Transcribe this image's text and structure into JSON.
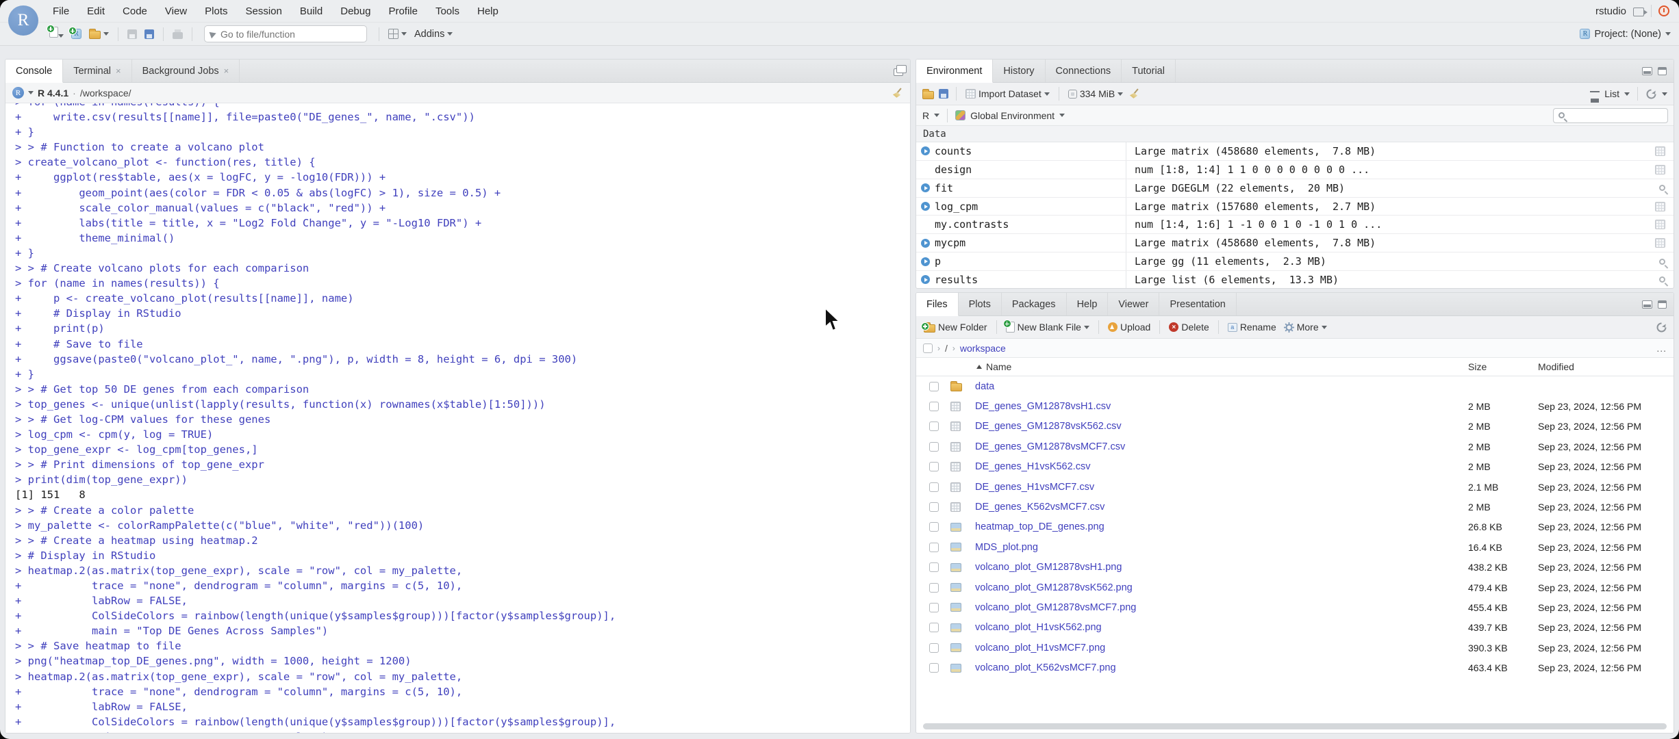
{
  "window": {
    "session_label": "rstudio",
    "project_label": "Project: (None)"
  },
  "colors": {
    "console_input": "#4040bd",
    "console_output": "#1b1b1b",
    "file_link": "#4040bd",
    "chrome": "#eceef0",
    "accent_logo": "#6b93c6",
    "power_icon": "#e0562c"
  },
  "menubar": {
    "items": [
      "File",
      "Edit",
      "Code",
      "View",
      "Plots",
      "Session",
      "Build",
      "Debug",
      "Profile",
      "Tools",
      "Help"
    ]
  },
  "toolbar": {
    "goto_placeholder": "Go to file/function",
    "addins_label": "Addins"
  },
  "console_panel": {
    "tabs": [
      {
        "label": "Console",
        "active": true,
        "closable": false
      },
      {
        "label": "Terminal",
        "active": false,
        "closable": true
      },
      {
        "label": "Background Jobs",
        "active": false,
        "closable": true
      }
    ],
    "r_version": "R 4.4.1",
    "separator": "·",
    "working_dir": "/workspace/",
    "lines": [
      {
        "k": "input",
        "t": "> for (name in names(results)) {"
      },
      {
        "k": "input",
        "t": "+     write.csv(results[[name]], file=paste0(\"DE_genes_\", name, \".csv\"))"
      },
      {
        "k": "input",
        "t": "+ }"
      },
      {
        "k": "input",
        "t": "> > # Function to create a volcano plot"
      },
      {
        "k": "input",
        "t": "> create_volcano_plot <- function(res, title) {"
      },
      {
        "k": "input",
        "t": "+     ggplot(res$table, aes(x = logFC, y = -log10(FDR))) +"
      },
      {
        "k": "input",
        "t": "+         geom_point(aes(color = FDR < 0.05 & abs(logFC) > 1), size = 0.5) +"
      },
      {
        "k": "input",
        "t": "+         scale_color_manual(values = c(\"black\", \"red\")) +"
      },
      {
        "k": "input",
        "t": "+         labs(title = title, x = \"Log2 Fold Change\", y = \"-Log10 FDR\") +"
      },
      {
        "k": "input",
        "t": "+         theme_minimal()"
      },
      {
        "k": "input",
        "t": "+ }"
      },
      {
        "k": "input",
        "t": "> > # Create volcano plots for each comparison"
      },
      {
        "k": "input",
        "t": "> for (name in names(results)) {"
      },
      {
        "k": "input",
        "t": "+     p <- create_volcano_plot(results[[name]], name)"
      },
      {
        "k": "input",
        "t": "+     # Display in RStudio"
      },
      {
        "k": "input",
        "t": "+     print(p)"
      },
      {
        "k": "input",
        "t": "+     # Save to file"
      },
      {
        "k": "input",
        "t": "+     ggsave(paste0(\"volcano_plot_\", name, \".png\"), p, width = 8, height = 6, dpi = 300)"
      },
      {
        "k": "input",
        "t": "+ }"
      },
      {
        "k": "input",
        "t": "> > # Get top 50 DE genes from each comparison"
      },
      {
        "k": "input",
        "t": "> top_genes <- unique(unlist(lapply(results, function(x) rownames(x$table)[1:50])))"
      },
      {
        "k": "input",
        "t": "> > # Get log-CPM values for these genes"
      },
      {
        "k": "input",
        "t": "> log_cpm <- cpm(y, log = TRUE)"
      },
      {
        "k": "input",
        "t": "> top_gene_expr <- log_cpm[top_genes,]"
      },
      {
        "k": "input",
        "t": "> > # Print dimensions of top_gene_expr"
      },
      {
        "k": "input",
        "t": "> print(dim(top_gene_expr))"
      },
      {
        "k": "output",
        "t": "[1] 151   8"
      },
      {
        "k": "input",
        "t": "> > # Create a color palette"
      },
      {
        "k": "input",
        "t": "> my_palette <- colorRampPalette(c(\"blue\", \"white\", \"red\"))(100)"
      },
      {
        "k": "input",
        "t": "> > # Create a heatmap using heatmap.2"
      },
      {
        "k": "input",
        "t": "> # Display in RStudio"
      },
      {
        "k": "input",
        "t": "> heatmap.2(as.matrix(top_gene_expr), scale = \"row\", col = my_palette,"
      },
      {
        "k": "input",
        "t": "+           trace = \"none\", dendrogram = \"column\", margins = c(5, 10),"
      },
      {
        "k": "input",
        "t": "+           labRow = FALSE,"
      },
      {
        "k": "input",
        "t": "+           ColSideColors = rainbow(length(unique(y$samples$group)))[factor(y$samples$group)],"
      },
      {
        "k": "input",
        "t": "+           main = \"Top DE Genes Across Samples\")"
      },
      {
        "k": "input",
        "t": "> > # Save heatmap to file"
      },
      {
        "k": "input",
        "t": "> png(\"heatmap_top_DE_genes.png\", width = 1000, height = 1200)"
      },
      {
        "k": "input",
        "t": "> heatmap.2(as.matrix(top_gene_expr), scale = \"row\", col = my_palette,"
      },
      {
        "k": "input",
        "t": "+           trace = \"none\", dendrogram = \"column\", margins = c(5, 10),"
      },
      {
        "k": "input",
        "t": "+           labRow = FALSE,"
      },
      {
        "k": "input",
        "t": "+           ColSideColors = rainbow(length(unique(y$samples$group)))[factor(y$samples$group)],"
      },
      {
        "k": "input",
        "t": "+           main = \"Top DE Genes Across Samples\")"
      }
    ]
  },
  "environment_panel": {
    "tabs": [
      "Environment",
      "History",
      "Connections",
      "Tutorial"
    ],
    "active_tab": "Environment",
    "toolbar": {
      "import_label": "Import Dataset",
      "memory_label": "334 MiB",
      "list_label": "List"
    },
    "scope": {
      "language": "R",
      "environment": "Global Environment"
    },
    "section_label": "Data",
    "objects": [
      {
        "name": "counts",
        "expandable": true,
        "value": "Large matrix (458680 elements,  7.8 MB)",
        "action": "grid"
      },
      {
        "name": "design",
        "expandable": false,
        "value": "num [1:8, 1:4] 1 1 0 0 0 0 0 0 0 0 ...",
        "action": "grid"
      },
      {
        "name": "fit",
        "expandable": true,
        "value": "Large DGEGLM (22 elements,  20 MB)",
        "action": "search"
      },
      {
        "name": "log_cpm",
        "expandable": true,
        "value": "Large matrix (157680 elements,  2.7 MB)",
        "action": "grid"
      },
      {
        "name": "my.contrasts",
        "expandable": false,
        "value": "num [1:4, 1:6] 1 -1 0 0 1 0 -1 0 1 0 ...",
        "action": "grid"
      },
      {
        "name": "mycpm",
        "expandable": true,
        "value": "Large matrix (458680 elements,  7.8 MB)",
        "action": "grid"
      },
      {
        "name": "p",
        "expandable": true,
        "value": "Large gg (11 elements,  2.3 MB)",
        "action": "search"
      },
      {
        "name": "results",
        "expandable": true,
        "value": "Large list (6 elements,  13.3 MB)",
        "action": "search"
      }
    ]
  },
  "files_panel": {
    "tabs": [
      "Files",
      "Plots",
      "Packages",
      "Help",
      "Viewer",
      "Presentation"
    ],
    "active_tab": "Files",
    "buttons": [
      {
        "label": "New Folder",
        "icon": "new-folder",
        "caret": false
      },
      {
        "label": "New Blank File",
        "icon": "new-file",
        "caret": true
      },
      {
        "label": "Upload",
        "icon": "upload",
        "caret": false
      },
      {
        "label": "Delete",
        "icon": "delete",
        "caret": false
      },
      {
        "label": "Rename",
        "icon": "rename",
        "caret": false
      },
      {
        "label": "More",
        "icon": "gear",
        "caret": true
      }
    ],
    "breadcrumb": [
      "/",
      "workspace"
    ],
    "ellipsis_label": "...",
    "columns": {
      "name": "Name",
      "size": "Size",
      "modified": "Modified"
    },
    "files": [
      {
        "name": "data",
        "type": "folder",
        "size": "",
        "modified": ""
      },
      {
        "name": "DE_genes_GM12878vsH1.csv",
        "type": "table",
        "size": "2 MB",
        "modified": "Sep 23, 2024, 12:56 PM"
      },
      {
        "name": "DE_genes_GM12878vsK562.csv",
        "type": "table",
        "size": "2 MB",
        "modified": "Sep 23, 2024, 12:56 PM"
      },
      {
        "name": "DE_genes_GM12878vsMCF7.csv",
        "type": "table",
        "size": "2 MB",
        "modified": "Sep 23, 2024, 12:56 PM"
      },
      {
        "name": "DE_genes_H1vsK562.csv",
        "type": "table",
        "size": "2 MB",
        "modified": "Sep 23, 2024, 12:56 PM"
      },
      {
        "name": "DE_genes_H1vsMCF7.csv",
        "type": "table",
        "size": "2.1 MB",
        "modified": "Sep 23, 2024, 12:56 PM"
      },
      {
        "name": "DE_genes_K562vsMCF7.csv",
        "type": "table",
        "size": "2 MB",
        "modified": "Sep 23, 2024, 12:56 PM"
      },
      {
        "name": "heatmap_top_DE_genes.png",
        "type": "image",
        "size": "26.8 KB",
        "modified": "Sep 23, 2024, 12:56 PM"
      },
      {
        "name": "MDS_plot.png",
        "type": "image",
        "size": "16.4 KB",
        "modified": "Sep 23, 2024, 12:56 PM"
      },
      {
        "name": "volcano_plot_GM12878vsH1.png",
        "type": "image",
        "size": "438.2 KB",
        "modified": "Sep 23, 2024, 12:56 PM"
      },
      {
        "name": "volcano_plot_GM12878vsK562.png",
        "type": "image",
        "size": "479.4 KB",
        "modified": "Sep 23, 2024, 12:56 PM"
      },
      {
        "name": "volcano_plot_GM12878vsMCF7.png",
        "type": "image",
        "size": "455.4 KB",
        "modified": "Sep 23, 2024, 12:56 PM"
      },
      {
        "name": "volcano_plot_H1vsK562.png",
        "type": "image",
        "size": "439.7 KB",
        "modified": "Sep 23, 2024, 12:56 PM"
      },
      {
        "name": "volcano_plot_H1vsMCF7.png",
        "type": "image",
        "size": "390.3 KB",
        "modified": "Sep 23, 2024, 12:56 PM"
      },
      {
        "name": "volcano_plot_K562vsMCF7.png",
        "type": "image",
        "size": "463.4 KB",
        "modified": "Sep 23, 2024, 12:56 PM"
      }
    ]
  }
}
